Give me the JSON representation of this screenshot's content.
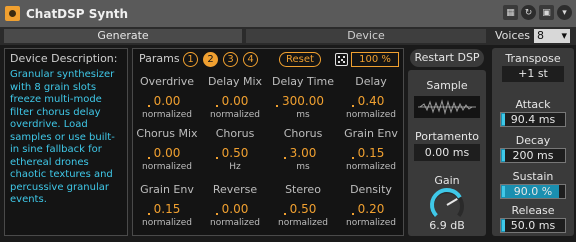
{
  "title": "ChatDSP Synth",
  "tabs": {
    "generate": "Generate",
    "device": "Device"
  },
  "voices": {
    "label": "Voices",
    "value": "8",
    "caret": "▾"
  },
  "description": {
    "title": "Device Description:",
    "text": "Granular synthesizer with 8 grain slots freeze multi-mode filter chorus delay overdrive. Load samples or use built-in sine fallback for ethereal drones chaotic textures and percussive granular events."
  },
  "params": {
    "label": "Params",
    "pages": [
      "1",
      "2",
      "3",
      "4"
    ],
    "active_page": 1,
    "reset": "Reset",
    "percent": "100 %",
    "cells": [
      {
        "label": "Overdrive",
        "value": "0.00",
        "unit": "normalized"
      },
      {
        "label": "Delay Mix",
        "value": "0.00",
        "unit": "normalized"
      },
      {
        "label": "Delay Time",
        "value": "300.00",
        "unit": "ms"
      },
      {
        "label": "Delay",
        "value": "0.40",
        "unit": "normalized"
      },
      {
        "label": "Chorus Mix",
        "value": "0.00",
        "unit": "normalized"
      },
      {
        "label": "Chorus",
        "value": "0.50",
        "unit": "Hz"
      },
      {
        "label": "Chorus",
        "value": "3.00",
        "unit": "ms"
      },
      {
        "label": "Grain Env",
        "value": "0.15",
        "unit": "normalized"
      },
      {
        "label": "Grain Env",
        "value": "0.15",
        "unit": "normalized"
      },
      {
        "label": "Reverse",
        "value": "0.00",
        "unit": "normalized"
      },
      {
        "label": "Stereo",
        "value": "0.50",
        "unit": "normalized"
      },
      {
        "label": "Density",
        "value": "0.20",
        "unit": "normalized"
      }
    ]
  },
  "restart": "Restart DSP",
  "sample": {
    "label": "Sample"
  },
  "portamento": {
    "label": "Portamento",
    "value": "0.00 ms"
  },
  "gain": {
    "label": "Gain",
    "value": "6.9 dB",
    "level": 0.72
  },
  "transpose": {
    "label": "Transpose",
    "value": "+1 st"
  },
  "envelope": [
    {
      "label": "Attack",
      "value": "90.4 ms",
      "level": 0.06
    },
    {
      "label": "Decay",
      "value": "200 ms",
      "level": 0.06
    },
    {
      "label": "Sustain",
      "value": "90.0 %",
      "level": 0.9
    },
    {
      "label": "Release",
      "value": "50.0 ms",
      "level": 0.06
    }
  ],
  "colors": {
    "accent": "#f0a030",
    "cyan": "#3fc8e8",
    "fill": "#1a8fb0"
  },
  "icons": [
    "power-icon",
    "calendar-icon",
    "link-icon",
    "save-icon",
    "collapse-icon",
    "dice-icon"
  ]
}
